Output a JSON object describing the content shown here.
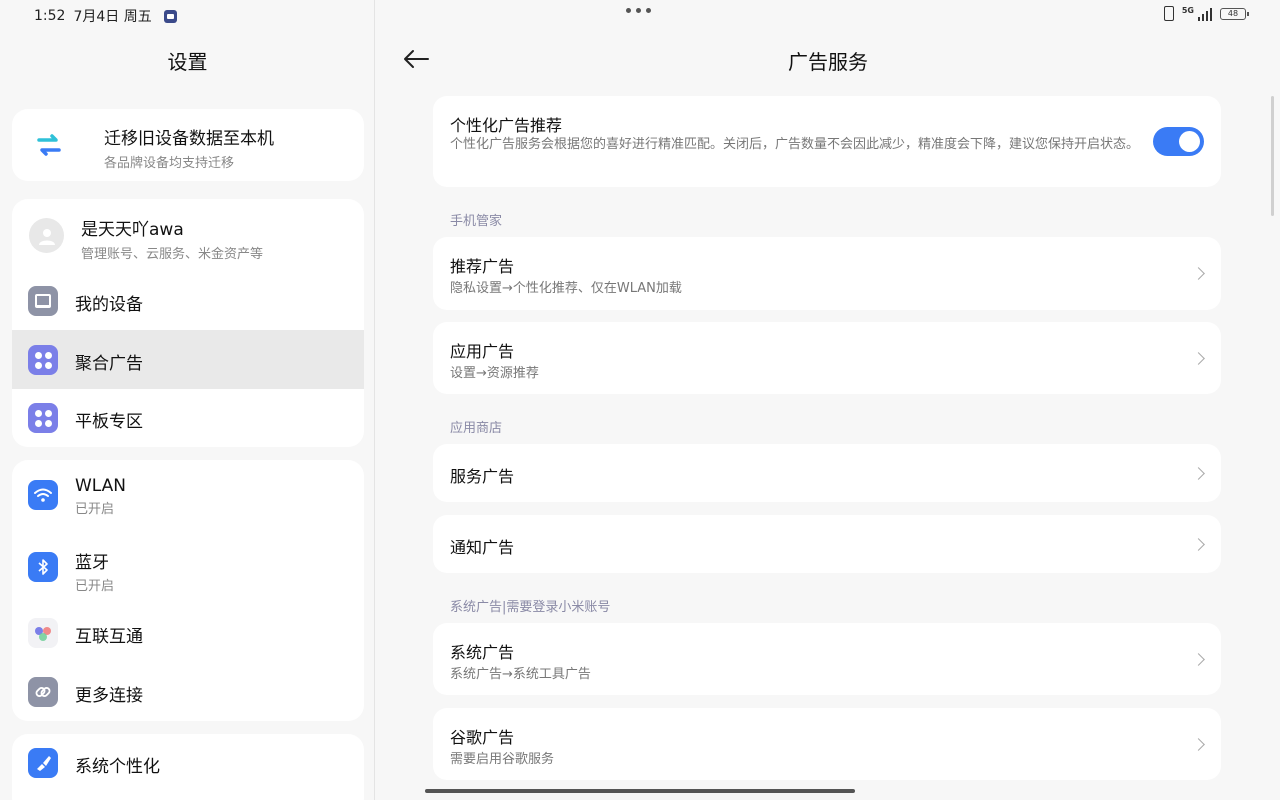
{
  "status": {
    "time": "1:52",
    "date": "7月4日 周五",
    "network": "5G",
    "battery": "48"
  },
  "left": {
    "title": "设置",
    "migrate": {
      "title": "迁移旧设备数据至本机",
      "subtitle": "各品牌设备均支持迁移"
    },
    "account": {
      "name": "是天天吖awa",
      "subtitle": "管理账号、云服务、米金资产等"
    },
    "items": [
      {
        "label": "我的设备"
      },
      {
        "label": "聚合广告"
      },
      {
        "label": "平板专区"
      }
    ],
    "conn": [
      {
        "label": "WLAN",
        "sub": "已开启"
      },
      {
        "label": "蓝牙",
        "sub": "已开启"
      },
      {
        "label": "互联互通"
      },
      {
        "label": "更多连接"
      }
    ],
    "personal": {
      "label": "系统个性化"
    }
  },
  "right": {
    "title": "广告服务",
    "personalized": {
      "title": "个性化广告推荐",
      "desc": "个性化广告服务会根据您的喜好进行精准匹配。关闭后，广告数量不会因此减少，精准度会下降，建议您保持开启状态。",
      "enabled": true
    },
    "sections": {
      "phone_manager": "手机管家",
      "app_store": "应用商店",
      "system": "系统广告|需要登录小米账号"
    },
    "cards": {
      "recommend": {
        "title": "推荐广告",
        "sub": "隐私设置→个性化推荐、仅在WLAN加载"
      },
      "app": {
        "title": "应用广告",
        "sub": "设置→资源推荐"
      },
      "service": {
        "title": "服务广告"
      },
      "notify": {
        "title": "通知广告"
      },
      "system": {
        "title": "系统广告",
        "sub": "系统广告→系统工具广告"
      },
      "google": {
        "title": "谷歌广告",
        "sub": "需要启用谷歌服务"
      }
    }
  },
  "colors": {
    "accent": "#3a7bf5",
    "selected_bg": "#e9e9e9"
  }
}
